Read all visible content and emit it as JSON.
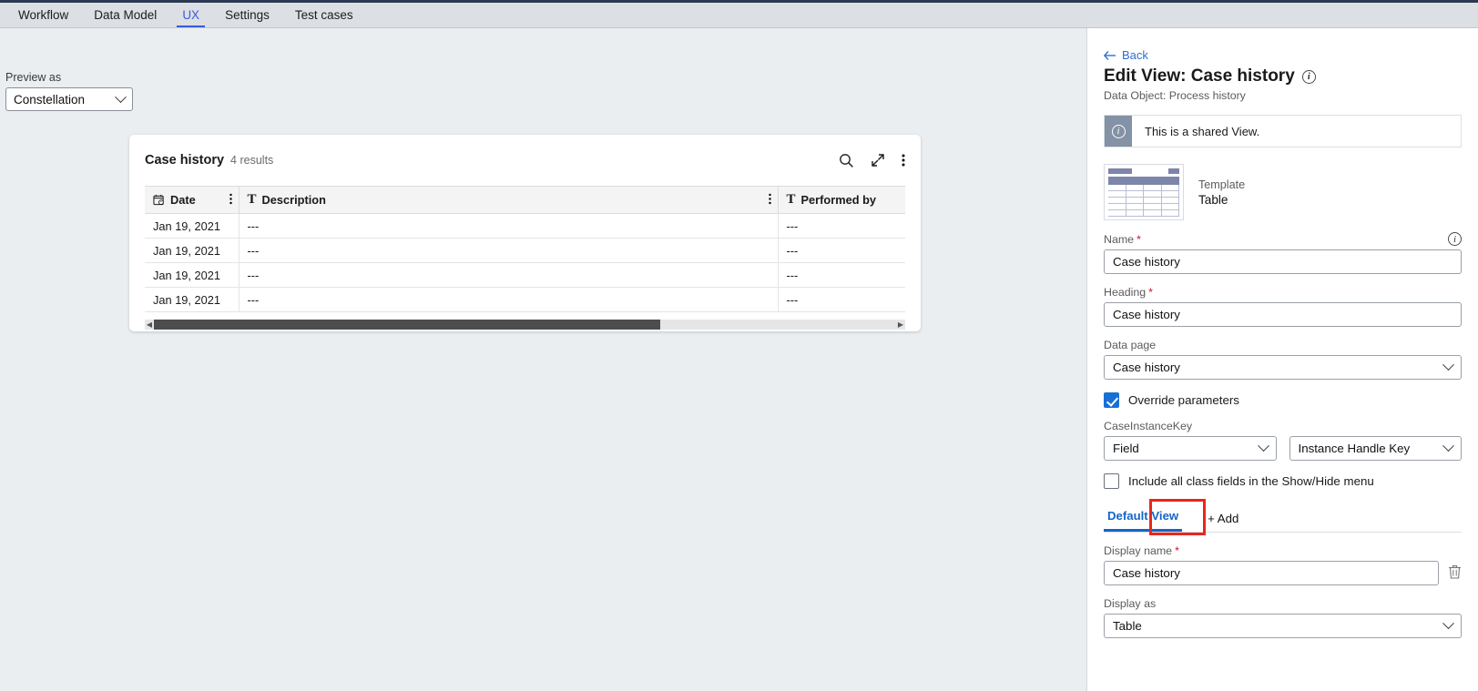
{
  "topbar": {
    "tabs": [
      {
        "label": "Workflow",
        "active": false
      },
      {
        "label": "Data Model",
        "active": false
      },
      {
        "label": "UX",
        "active": true
      },
      {
        "label": "Settings",
        "active": false
      },
      {
        "label": "Test cases",
        "active": false
      }
    ]
  },
  "preview": {
    "label": "Preview as",
    "value": "Constellation"
  },
  "card": {
    "title": "Case history",
    "count": "4 results",
    "actions": [
      "search-icon",
      "expand-icon",
      "more-vertical-icon"
    ],
    "columns": [
      {
        "label": "Date",
        "icon": "calendar-clock-icon"
      },
      {
        "label": "Description",
        "icon": "text-type-icon"
      },
      {
        "label": "Performed by",
        "icon": "text-type-icon"
      }
    ],
    "rows": [
      {
        "date": "Jan 19, 2021",
        "description": "---",
        "performed_by": "---"
      },
      {
        "date": "Jan 19, 2021",
        "description": "---",
        "performed_by": "---"
      },
      {
        "date": "Jan 19, 2021",
        "description": "---",
        "performed_by": "---"
      },
      {
        "date": "Jan 19, 2021",
        "description": "---",
        "performed_by": "---"
      }
    ]
  },
  "panel": {
    "back_label": "Back",
    "title": "Edit View: Case history",
    "subtitle": "Data Object: Process history",
    "banner_text": "This is a shared View.",
    "template": {
      "label": "Template",
      "value": "Table"
    },
    "name": {
      "label": "Name",
      "required": "*",
      "value": "Case history"
    },
    "heading": {
      "label": "Heading",
      "required": "*",
      "value": "Case history"
    },
    "data_page": {
      "label": "Data page",
      "value": "Case history"
    },
    "override": {
      "label": "Override parameters",
      "checked": true
    },
    "case_instance_key": {
      "label": "CaseInstanceKey",
      "left_value": "Field",
      "right_value": "Instance Handle Key"
    },
    "include_all": {
      "label": "Include all class fields in the Show/Hide menu",
      "checked": false
    },
    "view_tabs": [
      {
        "label": "Default View",
        "active": true
      },
      {
        "label": "+ Add",
        "active": false,
        "highlighted": true
      }
    ],
    "display_name": {
      "label": "Display name",
      "required": "*",
      "value": "Case history"
    },
    "display_as": {
      "label": "Display as",
      "value": "Table"
    }
  },
  "colors": {
    "accent_blue": "#3b5ae0",
    "link_blue": "#2f6fd0",
    "tab_blue": "#1565c8",
    "checkbox_blue": "#1870d5",
    "required_red": "#c8102e",
    "highlight_red": "#e8261f",
    "banner_icon": "#8392a5",
    "page_bg": "#eaeef1"
  }
}
